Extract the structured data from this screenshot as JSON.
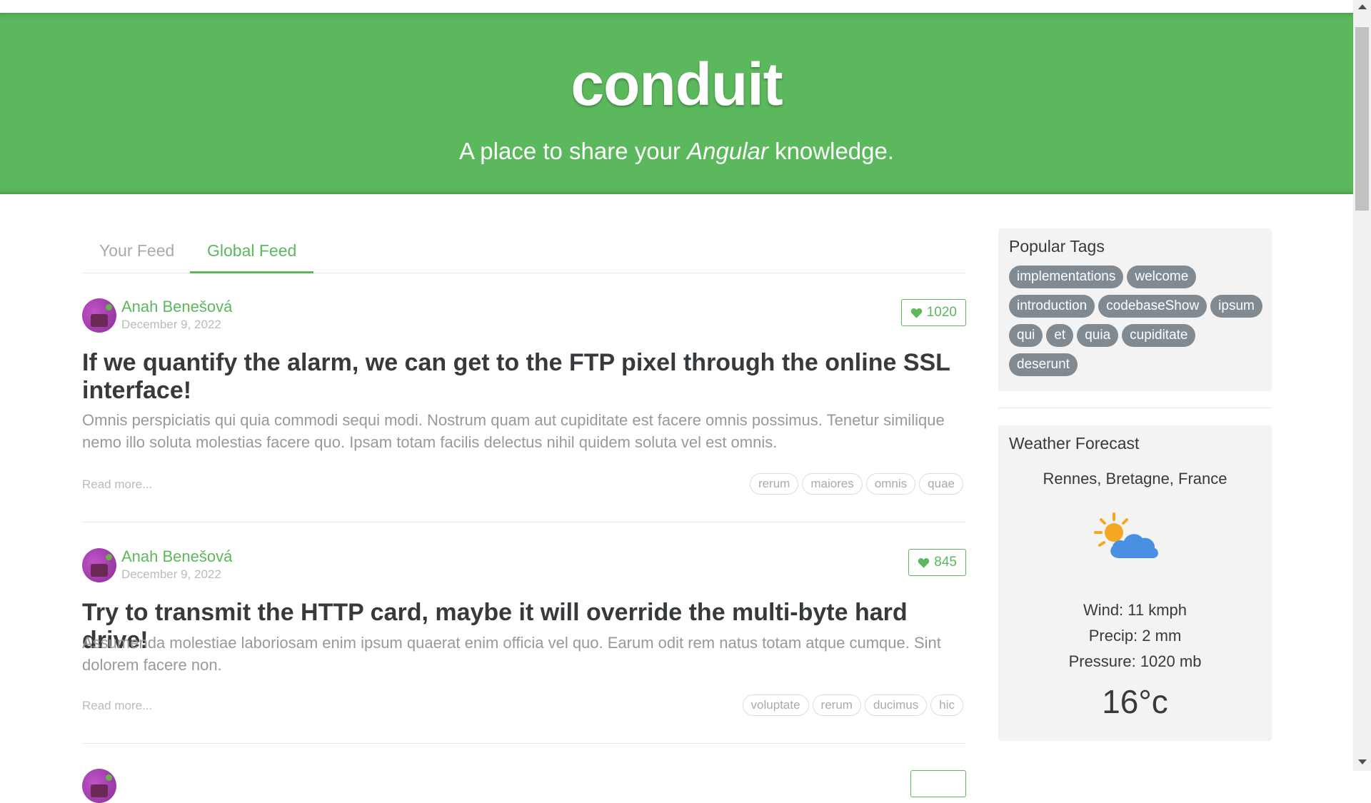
{
  "banner": {
    "title": "conduit",
    "subtitle_pre": "A place to share your ",
    "subtitle_em": "Angular",
    "subtitle_post": " knowledge."
  },
  "feed_tabs": [
    {
      "label": "Your Feed",
      "active": false
    },
    {
      "label": "Global Feed",
      "active": true
    }
  ],
  "articles": [
    {
      "author": "Anah Benešová",
      "date": "December 9, 2022",
      "likes": "1020",
      "title": "If we quantify the alarm, we can get to the FTP pixel through the online SSL interface!",
      "excerpt": "Omnis perspiciatis qui quia commodi sequi modi. Nostrum quam aut cupiditate est facere omnis possimus. Tenetur similique nemo illo soluta molestias facere quo. Ipsam totam facilis delectus nihil quidem soluta vel est omnis.",
      "read_more": "Read more...",
      "tags": [
        "rerum",
        "maiores",
        "omnis",
        "quae"
      ]
    },
    {
      "author": "Anah Benešová",
      "date": "December 9, 2022",
      "likes": "845",
      "title": "Try to transmit the HTTP card, maybe it will override the multi-byte hard drive!",
      "excerpt": "Assumenda molestiae laboriosam enim ipsum quaerat enim officia vel quo. Earum odit rem natus totam atque cumque. Sint dolorem facere non.",
      "read_more": "Read more...",
      "tags": [
        "voluptate",
        "rerum",
        "ducimus",
        "hic"
      ]
    }
  ],
  "sidebar": {
    "popular_tags_heading": "Popular Tags",
    "popular_tags": [
      "implementations",
      "welcome",
      "introduction",
      "codebaseShow",
      "ipsum",
      "qui",
      "et",
      "quia",
      "cupiditate",
      "deserunt"
    ],
    "weather": {
      "heading": "Weather Forecast",
      "location": "Rennes, Bretagne, France",
      "icon": "partly-cloudy-icon",
      "wind": "Wind: 11 kmph",
      "precip": "Precip: 2 mm",
      "pressure": "Pressure: 1020 mb",
      "temperature": "16°c"
    }
  },
  "colors": {
    "brand": "#5cb85c",
    "tag_pill": "#818a91",
    "card_bg": "#f3f3f3"
  }
}
